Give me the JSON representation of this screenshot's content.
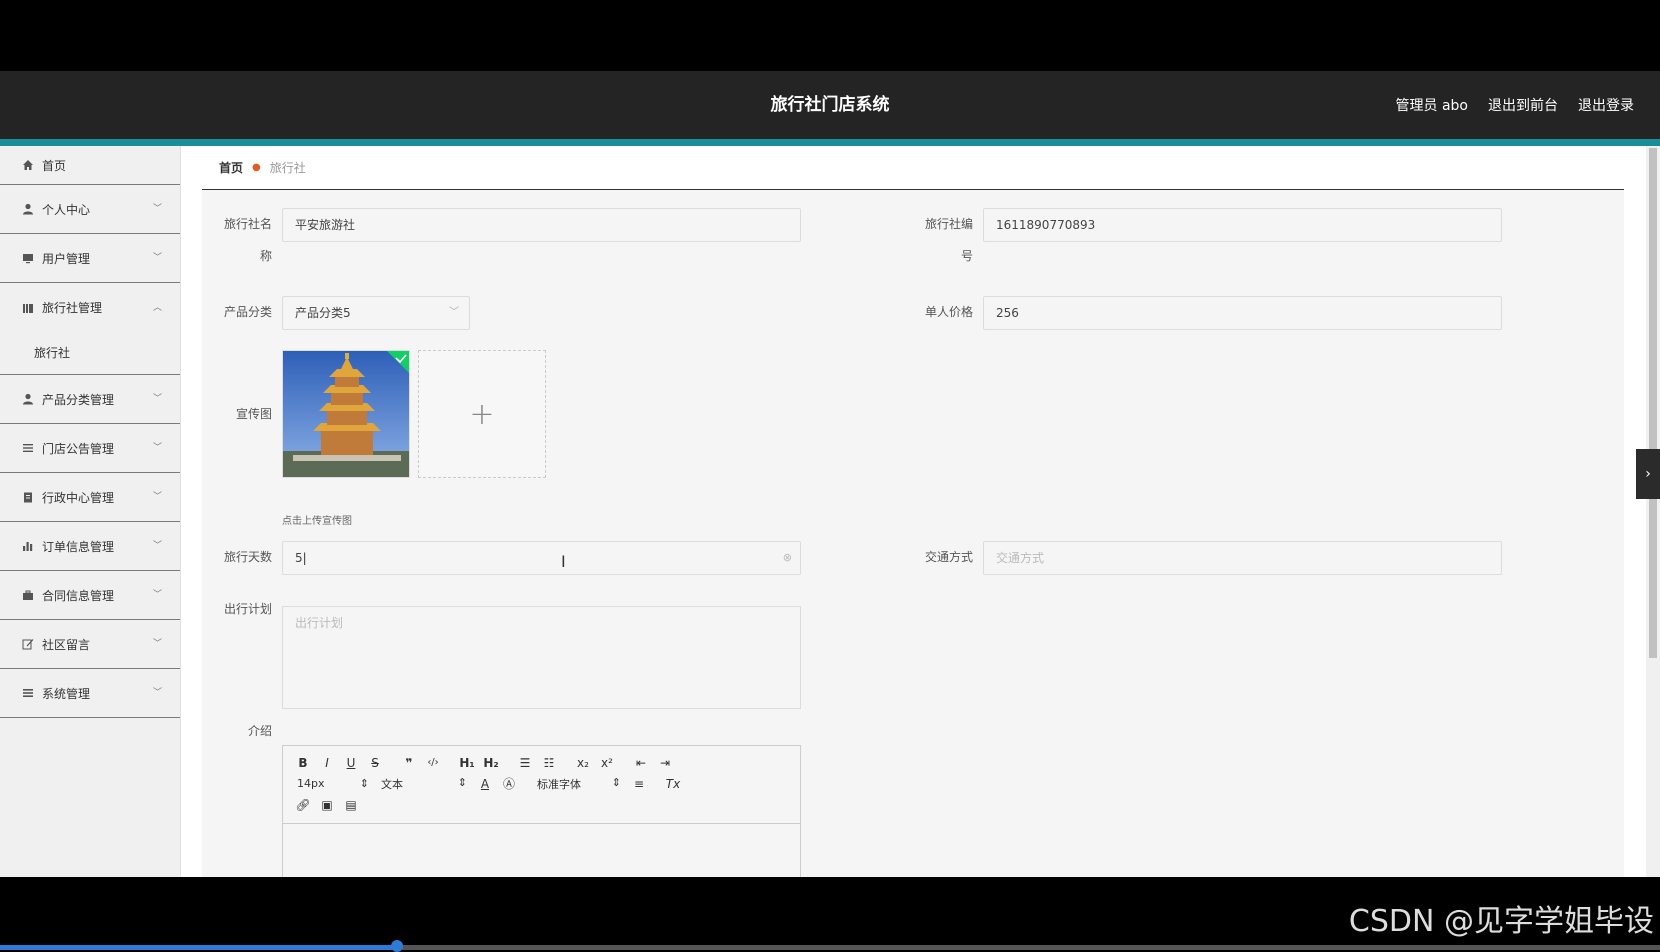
{
  "header": {
    "title": "旅行社门店系统",
    "admin": "管理员 abo",
    "to_front": "退出到前台",
    "logout": "退出登录"
  },
  "sidebar": {
    "items": [
      {
        "label": "首页",
        "icon": "home-icon"
      },
      {
        "label": "个人中心",
        "icon": "user-icon"
      },
      {
        "label": "用户管理",
        "icon": "monitor-icon"
      },
      {
        "label": "旅行社管理",
        "icon": "library-icon",
        "expanded": true,
        "children": [
          "旅行社"
        ]
      },
      {
        "label": "产品分类管理",
        "icon": "user-icon"
      },
      {
        "label": "门店公告管理",
        "icon": "list-icon"
      },
      {
        "label": "行政中心管理",
        "icon": "clipboard-icon"
      },
      {
        "label": "订单信息管理",
        "icon": "bar-chart-icon"
      },
      {
        "label": "合同信息管理",
        "icon": "briefcase-icon"
      },
      {
        "label": "社区留言",
        "icon": "edit-icon"
      },
      {
        "label": "系统管理",
        "icon": "menu-icon"
      }
    ]
  },
  "breadcrumb": {
    "home": "首页",
    "current": "旅行社"
  },
  "form": {
    "agency_name_label_1": "旅行社名",
    "agency_name_label_2": "称",
    "agency_name_value": "平安旅游社",
    "agency_no_label_1": "旅行社编",
    "agency_no_label_2": "号",
    "agency_no_value": "1611890770893",
    "category_label": "产品分类",
    "category_value": "产品分类5",
    "price_label": "单人价格",
    "price_value": "256",
    "image_label": "宣传图",
    "image_tip": "点击上传宣传图",
    "days_label": "旅行天数",
    "days_value": "5",
    "transport_label": "交通方式",
    "transport_placeholder": "交通方式",
    "plan_label": "出行计划",
    "plan_placeholder": "出行计划",
    "intro_label": "介绍"
  },
  "editor": {
    "font_size": "14px",
    "paragraph": "文本",
    "font_family": "标准字体"
  },
  "watermark": "CSDN @见字学姐毕设",
  "colors": {
    "header_bg": "#242424",
    "accent": "#1b8f97",
    "breadcrumb_sep": "#e05a2a",
    "upload_check": "#13ce66"
  },
  "video_progress": 0.24
}
